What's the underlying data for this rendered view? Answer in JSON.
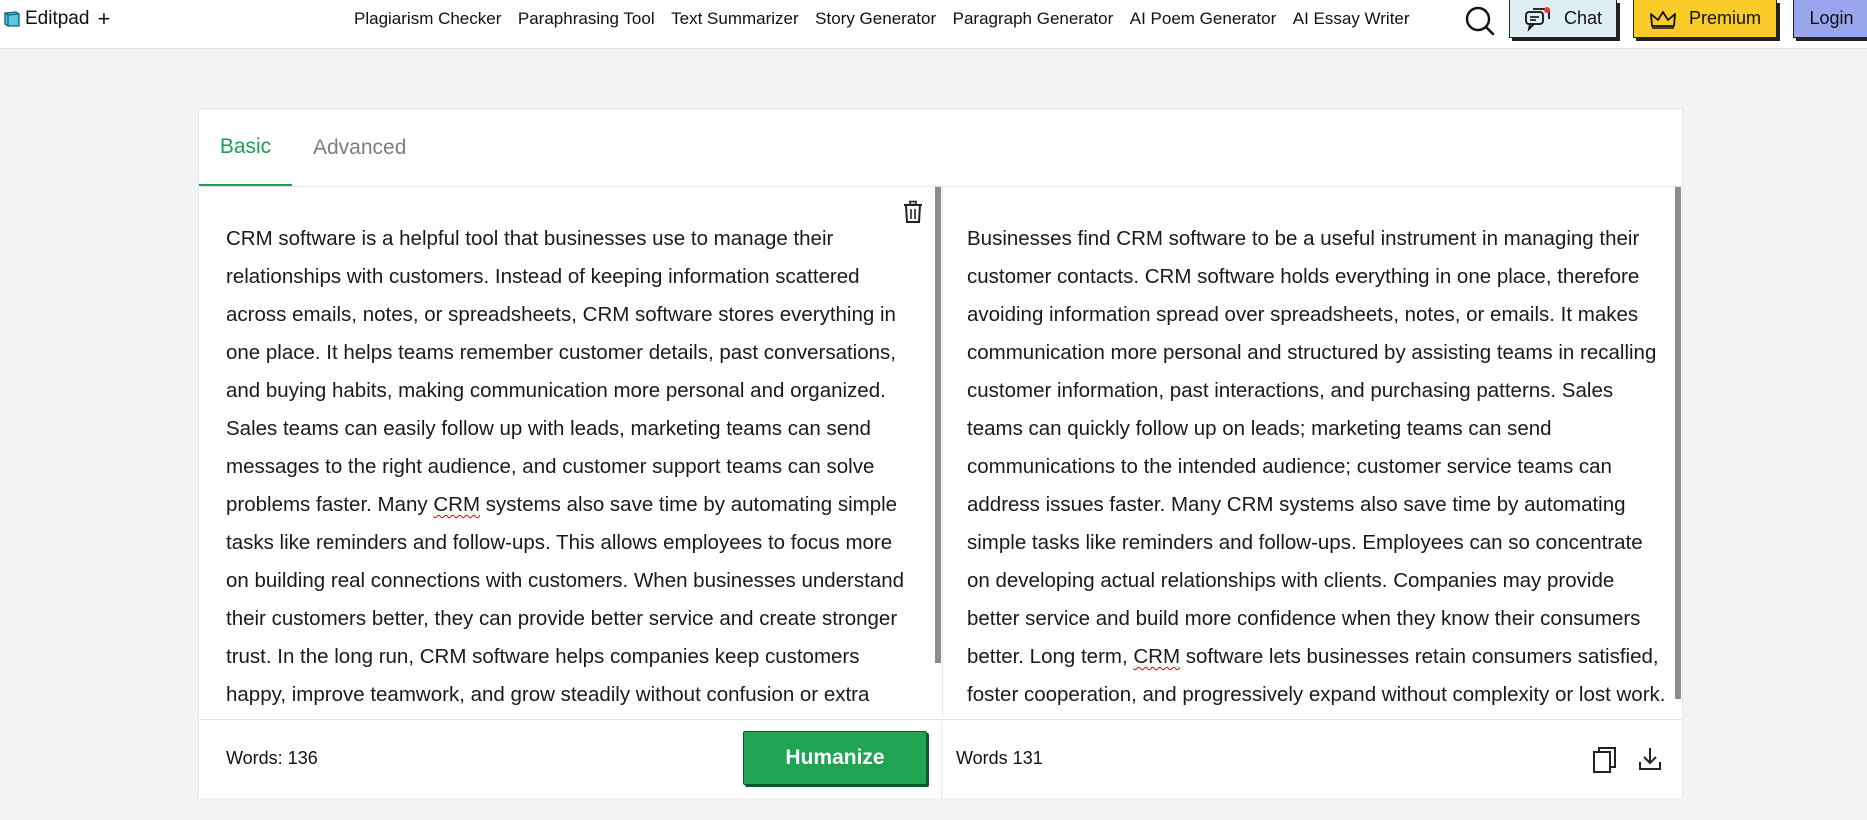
{
  "header": {
    "logo_text": "Editpad",
    "logo_plus": "+",
    "nav": [
      "Plagiarism Checker",
      "Paraphrasing Tool",
      "Text Summarizer",
      "Story Generator",
      "Paragraph Generator",
      "AI Poem Generator",
      "AI Essay Writer"
    ],
    "chat_label": "Chat",
    "premium_label": "Premium",
    "login_label": "Login"
  },
  "tabs": {
    "basic": "Basic",
    "advanced": "Advanced"
  },
  "input": {
    "text_before": "CRM software is a helpful tool that businesses use to manage their relationships with customers. Instead of keeping information scattered across emails, notes, or spreadsheets, CRM software stores everything in one place. It helps teams remember customer details, past conversations, and buying habits, making communication more personal and organized. Sales teams can easily follow up with leads, marketing teams can send messages to the right audience, and customer support teams can solve problems faster. Many ",
    "text_flagged": "CRM",
    "text_after": " systems also save time by automating simple tasks like reminders and follow-ups. This allows employees to focus more on building real connections with customers. When businesses understand their customers better, they can provide better service and create stronger trust. In the long run, CRM software helps companies keep customers happy, improve teamwork, and grow steadily without confusion or extra work.",
    "word_count": "Words: 136",
    "humanize_label": "Humanize"
  },
  "output": {
    "text_before": "Businesses find CRM software to be a useful instrument in managing their customer contacts. CRM software holds everything in one place, therefore avoiding information spread over spreadsheets, notes, or emails. It makes communication more personal and structured by assisting teams in recalling customer information, past interactions, and purchasing patterns. Sales teams can quickly follow up on leads; marketing teams can send communications to the intended audience; customer service teams can address issues faster. Many CRM systems also save time by automating simple tasks like reminders and follow-ups. Employees can so concentrate on developing actual relationships with clients. Companies may provide better service and build more confidence when they know their consumers better. Long term, ",
    "text_flagged": "CRM",
    "text_after": " software lets businesses retain consumers satisfied, foster cooperation, and progressively expand without complexity or lost work.",
    "word_count": "Words 131"
  },
  "colors": {
    "accent_green": "#1d9e52",
    "humanize_bg": "#1fa552",
    "premium_bg": "#f9cc2a",
    "login_bg": "#9aa6ec",
    "chat_bg": "#dfeef3"
  },
  "icons": {
    "logo": "book-icon",
    "search": "search-icon",
    "chat": "chat-bubble-icon",
    "premium": "crown-icon",
    "trash": "trash-icon",
    "copy": "copy-icon",
    "download": "download-icon"
  }
}
